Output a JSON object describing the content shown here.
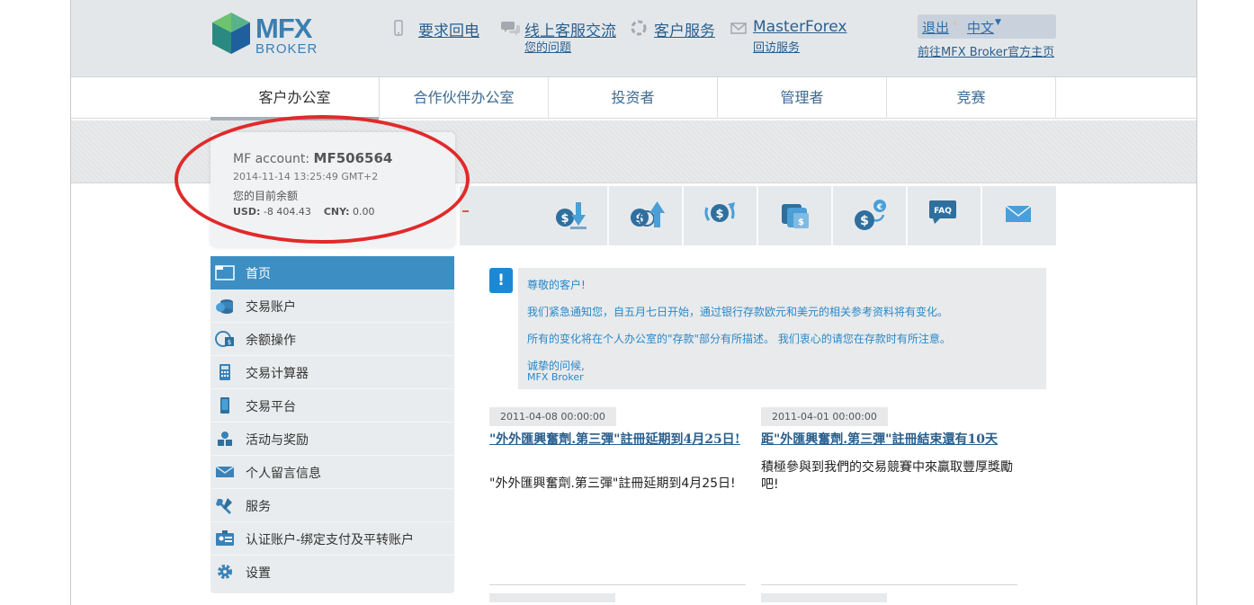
{
  "header": {
    "logo_main": "MFX",
    "logo_sub": "BROKER",
    "callback": "要求回电",
    "chat": "线上客服交流",
    "chat_sub": "您的问题",
    "service": "客户服务",
    "masterforex": "MasterForex",
    "masterforex_sub": "回访服务",
    "logout": "退出",
    "language": "中文",
    "official_site": "前往MFX Broker官方主页"
  },
  "nav": {
    "tabs": [
      {
        "label": "客户办公室"
      },
      {
        "label": "合作伙伴办公室"
      },
      {
        "label": "投资者"
      },
      {
        "label": "管理者"
      },
      {
        "label": "竞赛"
      }
    ]
  },
  "account": {
    "label": "MF account:",
    "number": "MF506564",
    "datetime": "2014-11-14 13:25:49 GMT+2",
    "balance_label": "您的目前余额",
    "usd_label": "USD:",
    "usd_value": "-8 404.43",
    "cny_label": "CNY:",
    "cny_value": "0.00"
  },
  "toolbar": {
    "tools": [
      {
        "icon": "deposit-icon"
      },
      {
        "icon": "withdraw-icon"
      },
      {
        "icon": "transfer-icon"
      },
      {
        "icon": "wallet-icon"
      },
      {
        "icon": "exchange-icon"
      },
      {
        "icon": "faq-icon",
        "text": "FAQ"
      },
      {
        "icon": "mail-icon"
      }
    ]
  },
  "sidebar": {
    "items": [
      {
        "label": "首页",
        "icon": "home-folder-icon"
      },
      {
        "label": "交易账户",
        "icon": "coins-icon"
      },
      {
        "label": "余额操作",
        "icon": "balance-icon"
      },
      {
        "label": "交易计算器",
        "icon": "calculator-icon"
      },
      {
        "label": "交易平台",
        "icon": "platform-icon"
      },
      {
        "label": "活动与奖励",
        "icon": "reward-icon"
      },
      {
        "label": "个人留言信息",
        "icon": "envelope-icon"
      },
      {
        "label": "服务",
        "icon": "wrench-icon"
      },
      {
        "label": "认证账户-绑定支付及平转账户",
        "icon": "id-card-icon"
      },
      {
        "label": "设置",
        "icon": "gear-icon"
      }
    ]
  },
  "notice": {
    "badge": "!",
    "greeting": "尊敬的客户!",
    "line1": "我们紧急通知您，自五月七日开始，通过银行存款欧元和美元的相关参考资料将有变化。",
    "line2": "所有的变化将在个人办公室的\"存款\"部分有所描述。 我们衷心的请您在存款时有所注意。",
    "closing": "诚挚的问候,",
    "signature": "MFX Broker"
  },
  "news": [
    {
      "date": "2011-04-08 00:00:00",
      "title": "\"外外匯興奮劑.第三彈\"註冊延期到4月25日!",
      "body": "\"外外匯興奮劑.第三彈\"註冊延期到4月25日!"
    },
    {
      "date": "2011-04-01 00:00:00",
      "title": "距\"外匯興奮劑.第三彈\"註冊結束還有10天",
      "body": "積極參與到我們的交易競賽中來贏取豐厚獎勵吧!"
    }
  ],
  "colors": {
    "accent": "#3d8ec2",
    "link": "#2b5f8c",
    "notice_text": "#2a88c8",
    "highlight": "#e02a2a"
  }
}
